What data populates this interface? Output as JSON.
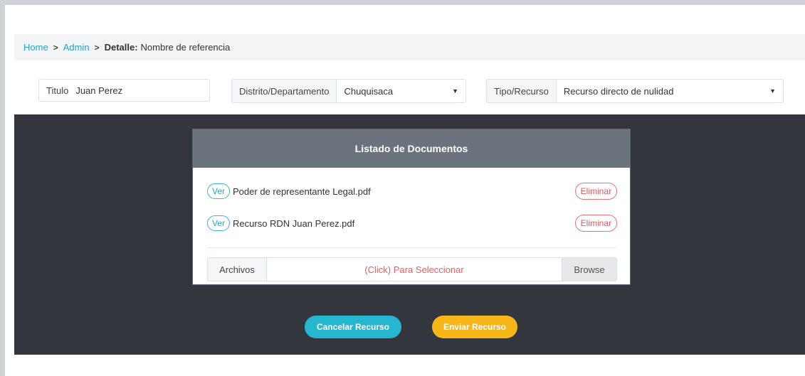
{
  "breadcrumb": {
    "home": "Home",
    "admin": "Admin",
    "current_label": "Detalle:",
    "current_value": "Nombre de referencia"
  },
  "filters": {
    "titulo": {
      "label": "Titulo",
      "value": "Juan Perez"
    },
    "distrito": {
      "label": "Distrito/Departamento",
      "value": "Chuquisaca"
    },
    "tipo": {
      "label": "Tipo/Recurso",
      "value": "Recurso directo de nulidad"
    }
  },
  "documents": {
    "title": "Listado de Documentos",
    "items": [
      {
        "view_label": "Ver",
        "name": "Poder de representante Legal.pdf",
        "delete_label": "Eliminar"
      },
      {
        "view_label": "Ver",
        "name": "Recurso RDN Juan Perez.pdf",
        "delete_label": "Eliminar"
      }
    ],
    "file_input": {
      "label": "Archivos",
      "placeholder": "(Click) Para Seleccionar",
      "browse_label": "Browse"
    }
  },
  "actions": {
    "cancel_label": "Cancelar Recurso",
    "send_label": "Enviar Recurso"
  },
  "colors": {
    "accent": "#29a3c6",
    "danger": "#e0535b",
    "warning": "#f7b718",
    "dark_bg": "#33373d",
    "panel_header": "#6b747c"
  }
}
